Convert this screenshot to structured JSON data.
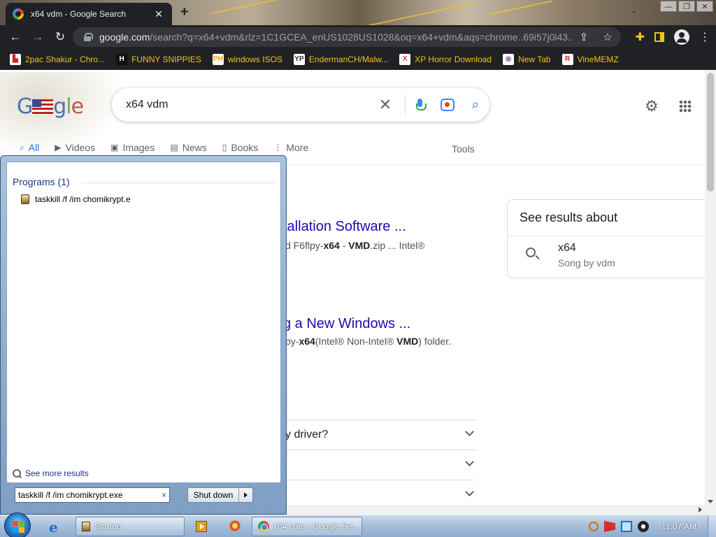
{
  "browser": {
    "tab_title": "x64 vdm - Google Search",
    "tab_close": "✕",
    "new_tab": "+",
    "url_host": "google.com",
    "url_rest": "/search?q=x64+vdm&rlz=1C1GCEA_enUS1028US1028&oq=x64+vdm&aqs=chrome..69i57j0i43..."
  },
  "bookmarks": [
    {
      "label": "2pac Shakur - Chro...",
      "icon": "red-car-icon",
      "icon_text": "▙",
      "color": "#c62828"
    },
    {
      "label": "FUNNY SNIPPIES",
      "icon": "h-logo-icon",
      "icon_text": "H",
      "color": "#ffffff"
    },
    {
      "label": "windows ISOS",
      "icon": "ph-logo-icon",
      "icon_text": "PH",
      "color": "#f39c12"
    },
    {
      "label": "EndermanCH/Malw...",
      "icon": "yp-logo-icon",
      "icon_text": "YP",
      "color": "#333333"
    },
    {
      "label": "XP Horror Download",
      "icon": "x-logo-icon",
      "icon_text": "X",
      "color": "#e53935"
    },
    {
      "label": "New Tab",
      "icon": "globe-icon",
      "icon_text": "◉",
      "color": "#9c7bb8"
    },
    {
      "label": "VineMEMZ",
      "icon": "r-logo-icon",
      "icon_text": "R",
      "color": "#c62828"
    }
  ],
  "google": {
    "query": "x64 vdm",
    "tabs": [
      {
        "label": "All",
        "icon": "⌕"
      },
      {
        "label": "Videos",
        "icon": "▶"
      },
      {
        "label": "Images",
        "icon": "▣"
      },
      {
        "label": "News",
        "icon": "▤"
      },
      {
        "label": "Books",
        "icon": "▯"
      },
      {
        "label": "More",
        "icon": "⋮"
      }
    ],
    "tools": "Tools",
    "result1_title": "tallation Software ...",
    "result1_snip_a": "d F6flpy-",
    "result1_snip_b": "x64",
    "result1_snip_c": " - ",
    "result1_snip_d": "VMD",
    "result1_snip_e": ".zip ... Intel®",
    "result2_title": "g a New Windows ...",
    "result2_snip_a": "py-",
    "result2_snip_b": "x64",
    "result2_snip_c": "(Intel® Non-Intel® ",
    "result2_snip_d": "VMD",
    "result2_snip_e": ") folder.",
    "paa": [
      "y driver?",
      "",
      ""
    ],
    "kp_title": "See results about",
    "kp_name": "x64",
    "kp_sub": "Song by vdm"
  },
  "startmenu": {
    "programs_header": "Programs (1)",
    "program_item": "taskkill /f /im chomikrypt.e",
    "see_more": "See more results",
    "search_value": "taskkill /f /im chomikrypt.exe",
    "search_clear": "×",
    "shutdown": "Shut down"
  },
  "taskbar": {
    "startup": "Startup",
    "chrome": "x64 vdm - Google Se...",
    "clock": "11:07 AM"
  },
  "colors": {
    "link": "#1a0dab",
    "active_tab": "#1a73e8",
    "bookmark_text": "#f0c419"
  }
}
